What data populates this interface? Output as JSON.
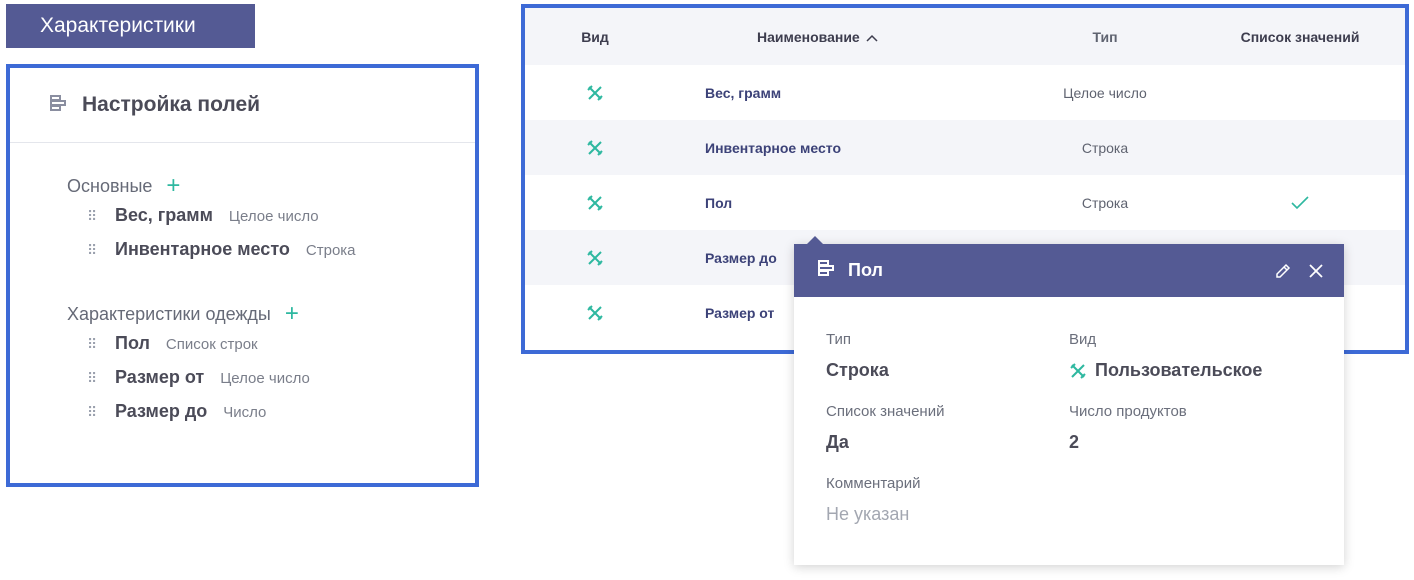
{
  "tag": {
    "label": "Характеристики"
  },
  "left_panel": {
    "title": "Настройка полей",
    "groups": [
      {
        "title": "Основные",
        "fields": [
          {
            "name": "Вес, грамм",
            "type": "Целое число"
          },
          {
            "name": "Инвентарное место",
            "type": "Строка"
          }
        ]
      },
      {
        "title": "Характеристики одежды",
        "fields": [
          {
            "name": "Пол",
            "type": "Список строк"
          },
          {
            "name": "Размер от",
            "type": "Целое число"
          },
          {
            "name": "Размер до",
            "type": "Число"
          }
        ]
      }
    ]
  },
  "table": {
    "columns": {
      "vid": "Вид",
      "name": "Наименование",
      "type": "Тип",
      "list": "Список значений"
    },
    "rows": [
      {
        "name": "Вес, грамм",
        "type": "Целое число",
        "list": false
      },
      {
        "name": "Инвентарное место",
        "type": "Строка",
        "list": false
      },
      {
        "name": "Пол",
        "type": "Строка",
        "list": true
      },
      {
        "name": "Размер до",
        "type": "",
        "list": false
      },
      {
        "name": "Размер от",
        "type": "",
        "list": false
      }
    ]
  },
  "popup": {
    "title": "Пол",
    "type_label": "Тип",
    "type_value": "Строка",
    "kind_label": "Вид",
    "kind_value": "Пользовательское",
    "list_label": "Список значений",
    "list_value": "Да",
    "products_label": "Число продуктов",
    "products_value": "2",
    "comment_label": "Комментарий",
    "comment_value": "Не указан"
  },
  "colors": {
    "accent": "#545a94",
    "border": "#3d6ad6",
    "teal": "#2eb8a0"
  },
  "icons": [
    "fields-icon",
    "plus-icon",
    "drag-handle-icon",
    "custom-field-icon",
    "check-icon",
    "pencil-icon",
    "close-icon",
    "sort-asc-icon"
  ]
}
